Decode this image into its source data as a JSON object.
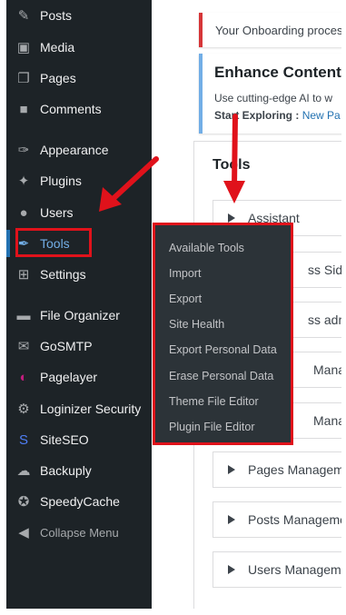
{
  "sidebar": {
    "items": [
      {
        "label": "Posts",
        "icon": "pin-icon"
      },
      {
        "label": "Media",
        "icon": "media-icon"
      },
      {
        "label": "Pages",
        "icon": "pages-icon"
      },
      {
        "label": "Comments",
        "icon": "comments-icon"
      },
      {
        "label": "Appearance",
        "icon": "brush-icon"
      },
      {
        "label": "Plugins",
        "icon": "plugin-icon"
      },
      {
        "label": "Users",
        "icon": "user-icon"
      },
      {
        "label": "Tools",
        "icon": "wrench-icon",
        "active": true
      },
      {
        "label": "Settings",
        "icon": "settings-icon"
      },
      {
        "label": "File Organizer",
        "icon": "folder-icon"
      },
      {
        "label": "GoSMTP",
        "icon": "mail-icon"
      },
      {
        "label": "Pagelayer",
        "icon": "pagelayer-icon"
      },
      {
        "label": "Loginizer Security",
        "icon": "gear-icon"
      },
      {
        "label": "SiteSEO",
        "icon": "siteseo-icon"
      },
      {
        "label": "Backuply",
        "icon": "cloud-icon"
      },
      {
        "label": "SpeedyCache",
        "icon": "speed-icon"
      }
    ],
    "collapse_label": "Collapse Menu"
  },
  "tools_submenu": [
    "Available Tools",
    "Import",
    "Export",
    "Site Health",
    "Export Personal Data",
    "Erase Personal Data",
    "Theme File Editor",
    "Plugin File Editor"
  ],
  "notices": {
    "onboarding": "Your Onboarding proces",
    "enhance_title": "Enhance Content V",
    "enhance_text": "Use cutting-edge AI to w",
    "start_label": "Start Exploring : ",
    "start_link": "New Pa"
  },
  "tools_panel": {
    "title": "Tools",
    "accordions": [
      "Assistant",
      "ss Sideb",
      "ss admi",
      "Manage",
      "Manage",
      "Pages Managem",
      "Posts Manageme",
      "Users Managem"
    ]
  },
  "colors": {
    "highlight": "#e0121b",
    "sidebar_bg": "#1d2327",
    "active": "#72aee6"
  }
}
